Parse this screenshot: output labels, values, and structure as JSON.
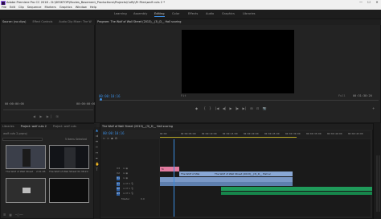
{
  "window": {
    "title": "Adobe Premiere Pro CC 2018 - D:\\DESKTOP\\Movies_Basement_Productions\\Projects\\Coffy\\Pr Files\\wolf cuts 2 *",
    "minimize": "—",
    "maximize": "☐",
    "close": "✕"
  },
  "menu": [
    "File",
    "Edit",
    "Clip",
    "Sequence",
    "Markers",
    "Graphics",
    "Window",
    "Help"
  ],
  "workspaces": [
    {
      "label": "Learning",
      "active": false
    },
    {
      "label": "Assembly",
      "active": false
    },
    {
      "label": "Editing",
      "active": true
    },
    {
      "label": "Color",
      "active": false
    },
    {
      "label": "Effects",
      "active": false
    },
    {
      "label": "Audio",
      "active": false
    },
    {
      "label": "Graphics",
      "active": false
    },
    {
      "label": "Libraries",
      "active": false
    }
  ],
  "source_panel": {
    "tabs": [
      "Source: (no clips)",
      "Effect Controls",
      "Audio Clip Mixer: The W"
    ],
    "timecode_left": "00:00:00:00",
    "timecode_right": "00:00:00:00"
  },
  "program_panel": {
    "title": "Program: The Wolf of Wall Street (2013)__(3)_D__ Hall scoring",
    "timecode": "00:00:10:16",
    "fit": "Fit",
    "quality": "Full",
    "duration": "00:31:38:20",
    "transport": [
      "◆",
      "{",
      "}",
      "|◀",
      "◀|",
      "▶",
      "|▶",
      "▶|",
      "⊞",
      "⊡",
      "📷"
    ]
  },
  "project_panel": {
    "tabs": [
      "Libraries",
      "Project: wolf cuts 2",
      "Project: wolf cuts"
    ],
    "bin": "wolf cuts 2.prproj",
    "count": "5 Items Selected",
    "items": [
      {
        "label": "The Wolf of Wall Street",
        "dur": "2:01:05"
      },
      {
        "label": "The Wolf of Wall Street",
        "dur": "31:38:20"
      },
      {
        "label": "",
        "dur": ""
      },
      {
        "label": "",
        "dur": ""
      }
    ]
  },
  "timeline": {
    "tab": "The Wolf of Wall Street (2013)__(3)_D__ Hall scoring",
    "timecode": "00:00:10:16",
    "ruler": [
      "00:00",
      "00:00:05:00",
      "00:00:10:00",
      "00:00:15:00",
      "00:00:20:00",
      "00:00:25:00",
      "00:00:30:00",
      "00:00:35:00",
      "00:00:40:00",
      "00:00:45:00"
    ],
    "video_tracks": [
      "V3",
      "V2",
      "V1"
    ],
    "audio_tracks": [
      "A1",
      "A2",
      "A3"
    ],
    "master": "Master",
    "master_value": "0.0",
    "clip_v1_label": "The Wolf of Wal",
    "clip_v1b_label": "The Wolf of Wall Street (2013)__(3)_D__ Hall sc",
    "clip_marker_label": "fx"
  },
  "colors": {
    "accent": "#3a8bde",
    "video_clip": "#89a8d6",
    "pink_clip": "#e37ba0",
    "audio_clip": "#1f9a5a",
    "work_area": "#b7a624"
  }
}
